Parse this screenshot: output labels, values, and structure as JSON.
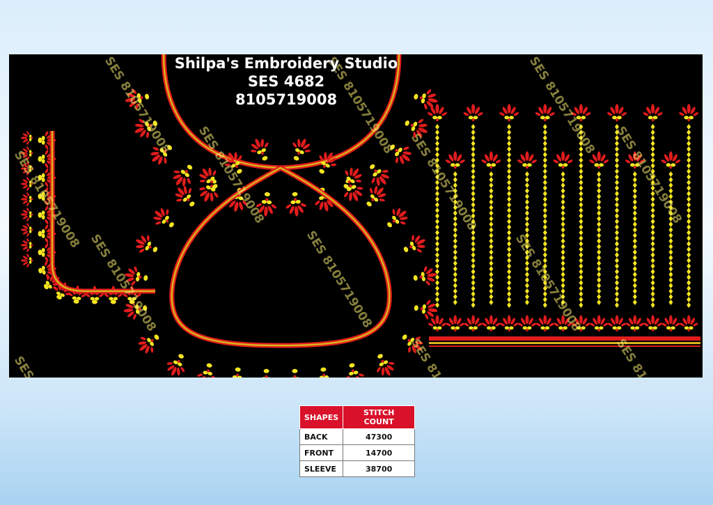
{
  "studio": {
    "name": "Shilpa's Embroidery Studio",
    "code": "SES  4682",
    "phone": "8105719008"
  },
  "watermark": "SES 8105719008",
  "colors": {
    "red": "#e01c1c",
    "yellow": "#f5e520",
    "gold": "#d9b21b",
    "background": "#000000",
    "header_red": "#d9112a"
  },
  "stitch_table": {
    "headers": [
      "SHAPES",
      "STITCH COUNT"
    ],
    "rows": [
      {
        "shape": "BACK",
        "count": "47300"
      },
      {
        "shape": "FRONT",
        "count": "14700"
      },
      {
        "shape": "SLEEVE",
        "count": "38700"
      }
    ]
  }
}
